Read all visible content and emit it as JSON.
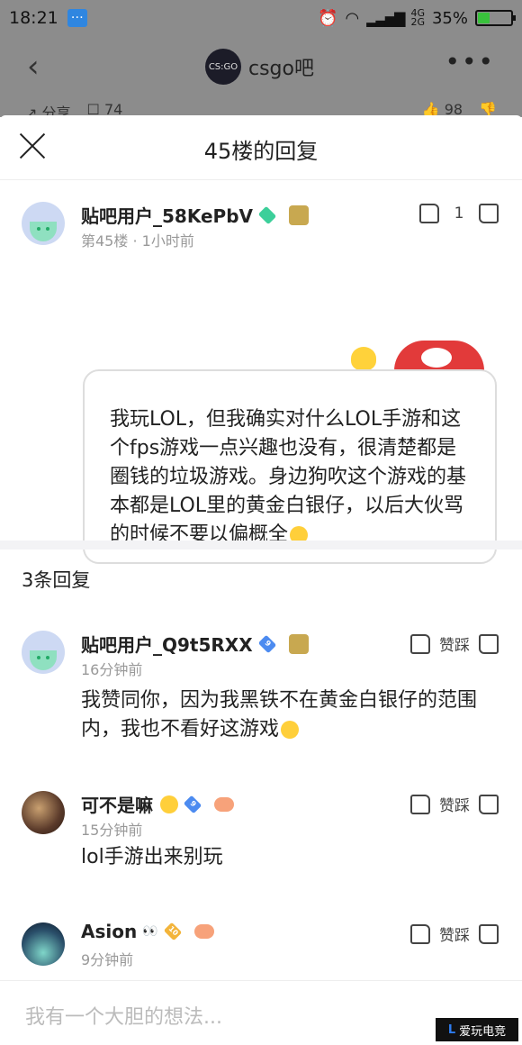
{
  "status_bar": {
    "time": "18:21",
    "network": [
      "4G",
      "2G"
    ],
    "battery": "35%",
    "battery_level": 0.35
  },
  "top_nav": {
    "forum_icon_text": "CS:GO",
    "forum_name": "csgo吧",
    "share_label": "分享",
    "comment_count": "74",
    "like_count": "98"
  },
  "sheet": {
    "title": "45楼的回复",
    "main_post": {
      "username": "贴吧用户_58KePbV",
      "floor": "第45楼",
      "time": "1小时前",
      "like_count": "1",
      "text": "我玩LOL，但我确实对什么LOL手游和这个fps游戏一点兴趣也没有，很清楚都是圈钱的垃圾游戏。身边狗吹这个游戏的基本都是LOL里的黄金白银仔，以后大伙骂的时候不要以偏概全"
    },
    "replies_count": "3条回复",
    "replies": [
      {
        "username": "贴吧用户_Q9t5RXX",
        "level": "9",
        "time": "16分钟前",
        "like_label": "赞踩",
        "text": "我赞同你，因为我黑铁不在黄金白银仔的范围内，我也不看好这游戏"
      },
      {
        "username": "可不是嘛",
        "level": "9",
        "time": "15分钟前",
        "like_label": "赞踩",
        "text": "lol手游出来别玩"
      },
      {
        "username": "Asion",
        "level": "10",
        "time": "9分钟前",
        "like_label": "赞踩",
        "text": ""
      }
    ],
    "input_placeholder": "我有一个大胆的想法..."
  },
  "watermark": {
    "brand_text": "爱玩电竞"
  },
  "colors": {
    "dim_overlay": "#8c8c8c",
    "accent_blue": "#4c8bf0",
    "badge_green": "#3ccf9a"
  }
}
